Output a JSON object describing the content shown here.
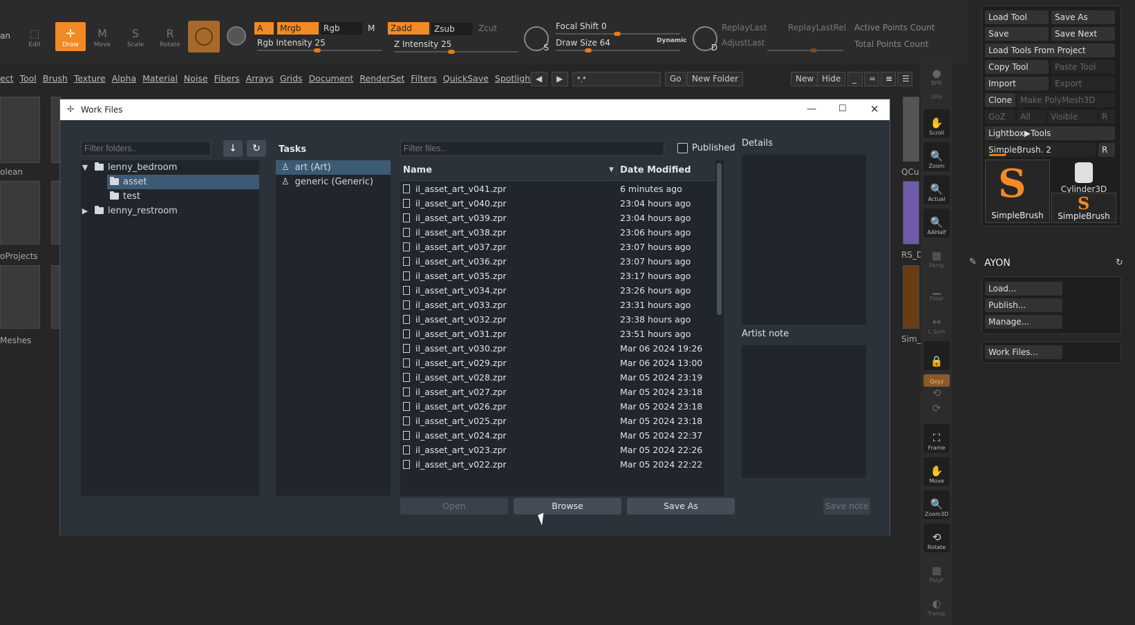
{
  "zbrush": {
    "toolbar": {
      "buttons": [
        "Edit",
        "Draw",
        "Move",
        "Scale",
        "Rotate"
      ],
      "left_label": "an",
      "chips": {
        "a": "A",
        "mrgb": "Mrgb",
        "rgb": "Rgb",
        "m": "M",
        "zadd": "Zadd",
        "zsub": "Zsub",
        "zcut": "Zcut"
      },
      "rgb_intensity": "Rgb Intensity 25",
      "z_intensity": "Z Intensity 25",
      "focal_shift": "Focal Shift 0",
      "draw_size": "Draw Size 64",
      "dynamic": "Dynamic",
      "replay_last": "ReplayLast",
      "replay_last_rel": "ReplayLastRel",
      "adjust_last": "AdjustLast",
      "active_points": "Active Points Count",
      "total_points": "Total Points Count",
      "s_label": "S",
      "d_label": "D"
    },
    "menu": [
      "ect",
      "Tool",
      "Brush",
      "Texture",
      "Alpha",
      "Material",
      "Noise",
      "Fibers",
      "Arrays",
      "Grids",
      "Document",
      "RenderSet",
      "Filters",
      "QuickSave",
      "Spotlight"
    ],
    "lightbox": {
      "filter": "*.*",
      "go": "Go",
      "new_folder": "New Folder",
      "new": "New",
      "hide": "Hide"
    },
    "left_labels": [
      "olean",
      "oProjects",
      "Meshes"
    ],
    "mid_labels": [
      "QCu",
      "RS_D",
      "Sim_"
    ],
    "tool_palette": {
      "load_tool": "Load Tool",
      "save_as": "Save As",
      "save": "Save",
      "save_next": "Save Next",
      "load_from_project": "Load Tools From Project",
      "copy_tool": "Copy Tool",
      "paste_tool": "Paste Tool",
      "import": "Import",
      "export": "Export",
      "clone": "Clone",
      "make_polymesh": "Make PolyMesh3D",
      "goz": "GoZ",
      "all": "All",
      "visible": "Visible",
      "r": "R",
      "lightbox_tools": "Lightbox▶Tools",
      "current_brush": "SimpleBrush. 2",
      "thumb1": "SimpleBrush",
      "thumb2": "Cylinder3D",
      "thumb3": "SimpleBrush"
    },
    "side_strip": [
      "BPR",
      "SPix",
      "Scroll",
      "Zoom",
      "Actual",
      "AAHalf",
      "Persp",
      "Floor",
      "L.Sym",
      "",
      "Qxyz",
      "",
      "",
      "Frame",
      "Move",
      "Zoom3D",
      "Rotate",
      "PolyF",
      "Transp"
    ],
    "ayon": {
      "title": "AYON",
      "load": "Load...",
      "publish": "Publish...",
      "manage": "Manage...",
      "work_files": "Work Files..."
    }
  },
  "dialog": {
    "title": "Work Files",
    "folder_filter_placeholder": "Filter folders..",
    "tree": [
      {
        "label": "lenny_bedroom",
        "level": 0,
        "expanded": true
      },
      {
        "label": "asset",
        "level": 1,
        "selected": true
      },
      {
        "label": "test",
        "level": 1
      },
      {
        "label": "lenny_restroom",
        "level": 0,
        "expanded": false
      }
    ],
    "tasks_header": "Tasks",
    "tasks": [
      {
        "label": "art (Art)",
        "selected": true
      },
      {
        "label": "generic (Generic)"
      }
    ],
    "file_filter_placeholder": "Filter files..",
    "published_label": "Published",
    "columns": {
      "name": "Name",
      "date": "Date Modified"
    },
    "files": [
      {
        "name": "il_asset_art_v041.zpr",
        "date": "6 minutes ago"
      },
      {
        "name": "il_asset_art_v040.zpr",
        "date": "23:04 hours ago"
      },
      {
        "name": "il_asset_art_v039.zpr",
        "date": "23:04 hours ago"
      },
      {
        "name": "il_asset_art_v038.zpr",
        "date": "23:06 hours ago"
      },
      {
        "name": "il_asset_art_v037.zpr",
        "date": "23:07 hours ago"
      },
      {
        "name": "il_asset_art_v036.zpr",
        "date": "23:07 hours ago"
      },
      {
        "name": "il_asset_art_v035.zpr",
        "date": "23:17 hours ago"
      },
      {
        "name": "il_asset_art_v034.zpr",
        "date": "23:26 hours ago"
      },
      {
        "name": "il_asset_art_v033.zpr",
        "date": "23:31 hours ago"
      },
      {
        "name": "il_asset_art_v032.zpr",
        "date": "23:38 hours ago"
      },
      {
        "name": "il_asset_art_v031.zpr",
        "date": "23:51 hours ago"
      },
      {
        "name": "il_asset_art_v030.zpr",
        "date": "Mar 06 2024 19:26"
      },
      {
        "name": "il_asset_art_v029.zpr",
        "date": "Mar 06 2024 13:00"
      },
      {
        "name": "il_asset_art_v028.zpr",
        "date": "Mar 05 2024 23:19"
      },
      {
        "name": "il_asset_art_v027.zpr",
        "date": "Mar 05 2024 23:18"
      },
      {
        "name": "il_asset_art_v026.zpr",
        "date": "Mar 05 2024 23:18"
      },
      {
        "name": "il_asset_art_v025.zpr",
        "date": "Mar 05 2024 23:18"
      },
      {
        "name": "il_asset_art_v024.zpr",
        "date": "Mar 05 2024 22:37"
      },
      {
        "name": "il_asset_art_v023.zpr",
        "date": "Mar 05 2024 22:26"
      },
      {
        "name": "il_asset_art_v022.zpr",
        "date": "Mar 05 2024 22:22"
      }
    ],
    "details_label": "Details",
    "artist_note_label": "Artist note",
    "buttons": {
      "open": "Open",
      "browse": "Browse",
      "save_as": "Save As",
      "save_note": "Save note"
    }
  }
}
